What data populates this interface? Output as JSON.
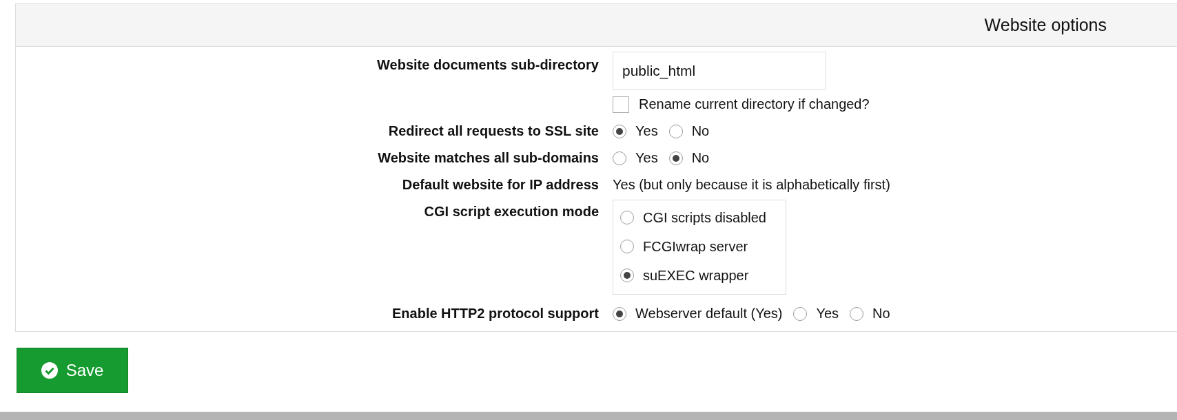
{
  "panel": {
    "title": "Website options",
    "rows": [
      {
        "kind": "input",
        "label": "Website documents sub-directory",
        "value": "public_html",
        "checkbox": {
          "label": "Rename current directory if changed?",
          "checked": false
        }
      },
      {
        "kind": "radio",
        "label": "Redirect all requests to SSL site",
        "options": [
          {
            "label": "Yes",
            "selected": true
          },
          {
            "label": "No",
            "selected": false
          }
        ]
      },
      {
        "kind": "radio",
        "label": "Website matches all sub-domains",
        "options": [
          {
            "label": "Yes",
            "selected": false
          },
          {
            "label": "No",
            "selected": true
          }
        ]
      },
      {
        "kind": "text",
        "label": "Default website for IP address",
        "value": "Yes (but only because it is alphabetically first)"
      },
      {
        "kind": "radio_list",
        "label": "CGI script execution mode",
        "options": [
          {
            "label": "CGI scripts disabled",
            "selected": false
          },
          {
            "label": "FCGIwrap server",
            "selected": false
          },
          {
            "label": "suEXEC wrapper",
            "selected": true
          }
        ]
      },
      {
        "kind": "radio",
        "label": "Enable HTTP2 protocol support",
        "options": [
          {
            "label": "Webserver default (Yes)",
            "selected": true
          },
          {
            "label": "Yes",
            "selected": false
          },
          {
            "label": "No",
            "selected": false
          }
        ]
      }
    ]
  },
  "save_button": {
    "label": "Save"
  }
}
